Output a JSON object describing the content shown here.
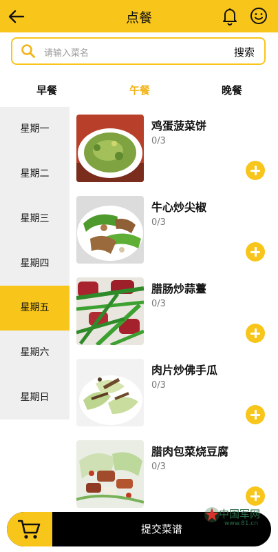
{
  "header": {
    "title": "点餐"
  },
  "search": {
    "placeholder": "请输入菜名",
    "button": "搜索"
  },
  "meal_tabs": [
    {
      "label": "早餐",
      "active": false
    },
    {
      "label": "午餐",
      "active": true
    },
    {
      "label": "晚餐",
      "active": false
    }
  ],
  "days": [
    {
      "label": "星期一",
      "active": false
    },
    {
      "label": "星期二",
      "active": false
    },
    {
      "label": "星期三",
      "active": false
    },
    {
      "label": "星期四",
      "active": false
    },
    {
      "label": "星期五",
      "active": true
    },
    {
      "label": "星期六",
      "active": false
    },
    {
      "label": "星期日",
      "active": false
    }
  ],
  "dishes": [
    {
      "name": "鸡蛋菠菜饼",
      "count": "0/3"
    },
    {
      "name": "牛心炒尖椒",
      "count": "0/3"
    },
    {
      "name": "腊肠炒蒜薹",
      "count": "0/3"
    },
    {
      "name": "肉片炒佛手瓜",
      "count": "0/3"
    },
    {
      "name": "腊肉包菜烧豆腐",
      "count": "0/3"
    }
  ],
  "cart": {
    "submit_label": "提交菜谱"
  },
  "watermark": {
    "text": "中国军网",
    "url": "www.81.cn"
  },
  "colors": {
    "accent": "#f8c51a",
    "tab_active": "#f2b51a",
    "sidebar_bg": "#efefef",
    "bar": "#000000"
  }
}
